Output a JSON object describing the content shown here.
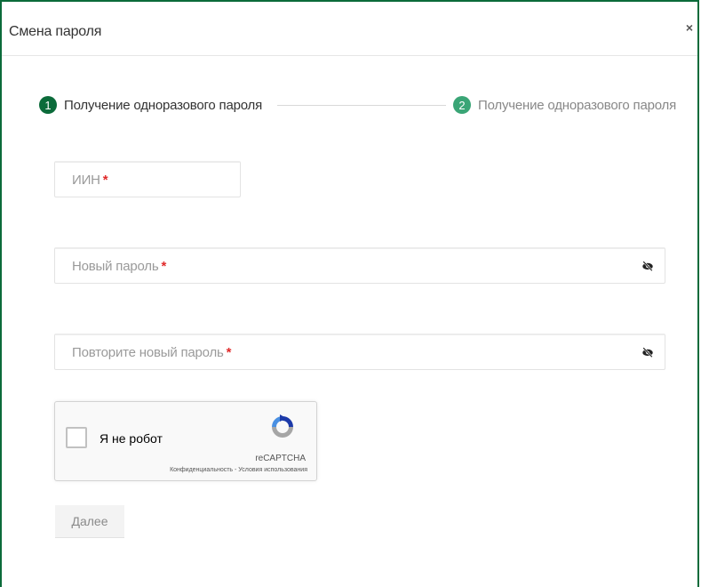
{
  "modal": {
    "title": "Смена пароля",
    "close_label": "×"
  },
  "stepper": {
    "steps": [
      {
        "number": "1",
        "label": "Получение одноразового пароля"
      },
      {
        "number": "2",
        "label": "Получение одноразового пароля"
      }
    ]
  },
  "form": {
    "iin": {
      "label": "ИИН",
      "required_mark": "*",
      "value": ""
    },
    "new_password": {
      "label": "Новый пароль",
      "required_mark": "*",
      "value": ""
    },
    "repeat_password": {
      "label": "Повторите новый пароль",
      "required_mark": "*",
      "value": ""
    }
  },
  "captcha": {
    "checkbox_label": "Я не робот",
    "brand": "reCAPTCHA",
    "terms": "Конфиденциальность - Условия использования",
    "checked": false
  },
  "actions": {
    "next_label": "Далее"
  },
  "colors": {
    "accent": "#0b6b3a",
    "step2": "#3aa576",
    "required": "#e02a2a"
  },
  "icons": {
    "close": "close-icon",
    "password_toggle": "eye-slash-icon",
    "captcha_logo": "recaptcha-logo-icon"
  }
}
